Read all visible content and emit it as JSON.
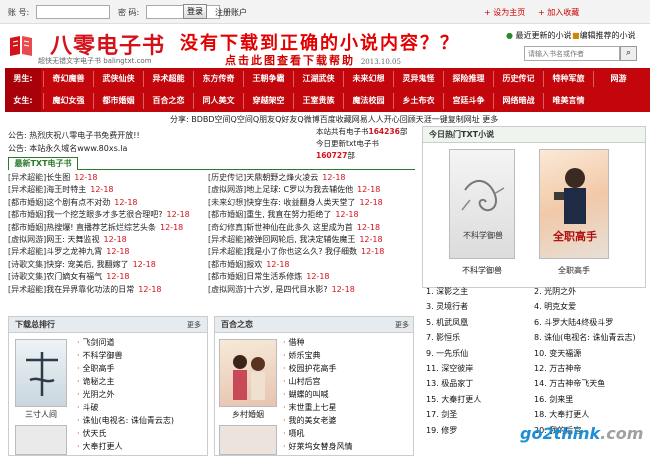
{
  "topbar": {
    "account_label": "账 号:",
    "password_label": "密 码:",
    "login_label": "登录",
    "register_label": "注册账户",
    "set_home": "+ 设为主页",
    "add_favorite": "+ 加入收藏"
  },
  "header": {
    "logo_title": "八零电子书",
    "logo_sub": "超快无错文字电子书 balingtxt.com",
    "slogan_main": "没有下载到正确的小说内容？？",
    "slogan_sub": "点击此图查看下载帮助",
    "slogan_date": "2013.10.05",
    "latest_update_link": "最近更新的小说",
    "recommend_link": "编辑推荐的小说",
    "search_placeholder": "请输入书名或作者",
    "search_icon": "magnifier-icon"
  },
  "nav": {
    "row1_label": "男生:",
    "row1": [
      "奇幻魔兽",
      "武侠仙侠",
      "异术超能",
      "东方传奇",
      "王朝争霸",
      "江湖武侠",
      "未来幻想",
      "灵异鬼怪",
      "探险推理",
      "历史传记",
      "特种军旅",
      "网游"
    ],
    "row2_label": "女生:",
    "row2": [
      "魔幻女强",
      "都市婚姻",
      "百合之恋",
      "同人美文",
      "穿越架空",
      "王室贵族",
      "魔法校园",
      "乡土布衣",
      "宫廷斗争",
      "网络暗战",
      "唯美言情"
    ]
  },
  "share": "分享: BDBD空间Q空间Q朋友Q好友Q微博百度收藏网易人人开心回顾天涯一键复制网址 更多",
  "notices": [
    "公告: 热烈庆祝八零电子书免费开放!!",
    "公告: 本站永久域名www.80xs.la"
  ],
  "stats": {
    "line1_prefix": "本站共有电子书",
    "line1_num": "164236",
    "line1_suffix": "部",
    "line2": "今日更新txt电子书",
    "line3_num": "160727",
    "line3_suffix": "部"
  },
  "latest": {
    "tab_label": "最新TXT电子书",
    "left": [
      {
        "cat": "[异术超能]",
        "title": "长生图",
        "date": "12-18"
      },
      {
        "cat": "[异术超能]",
        "title": "海王时特主",
        "date": "12-18"
      },
      {
        "cat": "[都市婚姻]",
        "title": "这个剧有点不对劲",
        "date": "12-18"
      },
      {
        "cat": "[都市婚姻]",
        "title": "我一个挖芝眼多才多艺很合理吧?",
        "date": "12-18"
      },
      {
        "cat": "[都市婚姻]",
        "title": "热搜爆! 直播荐艺拆烂综艺头条",
        "date": "12-18"
      },
      {
        "cat": "[虚拟网游]",
        "title": "网王: 天舞监视",
        "date": "12-18"
      },
      {
        "cat": "[异术超能]",
        "title": "斗罗之龙神九霄",
        "date": "12-18"
      },
      {
        "cat": "[诗歌文集]",
        "title": "快穿: 宠美后, 我翻嫁了",
        "date": "12-18"
      },
      {
        "cat": "[诗歌文集]",
        "title": "农门嫡女有福气",
        "date": "12-18"
      },
      {
        "cat": "[异术超能]",
        "title": "我在异界靠化功法的日常",
        "date": "12-18"
      }
    ],
    "right": [
      {
        "cat": "[历史传记]",
        "title": "天鼎朝野之烽火凌云",
        "date": "12-18"
      },
      {
        "cat": "[虚拟网游]",
        "title": "地上足球: C罗以为我去辅佐他",
        "date": "12-18"
      },
      {
        "cat": "[未来幻想]",
        "title": "快穿生存: 收益翻身人类天堂了",
        "date": "12-18"
      },
      {
        "cat": "[都市婚姻]",
        "title": "重生, 我直在努力拒绝了",
        "date": "12-18"
      },
      {
        "cat": "[奇幻修真]",
        "title": "斩世神仙在此多久 这里成为首",
        "date": "12-18"
      },
      {
        "cat": "[异术超能]",
        "title": "被弹回网轮后, 我决定辅佐魔王",
        "date": "12-18"
      },
      {
        "cat": "[异术超能]",
        "title": "我是小了你也这么久? 我仔细数",
        "date": "12-18"
      },
      {
        "cat": "[都市婚姻]",
        "title": "报欢",
        "date": "12-18"
      },
      {
        "cat": "[都市婚姻]",
        "title": "日常生活系修炼",
        "date": "12-18"
      },
      {
        "cat": "[虚拟网游]",
        "title": "十六岁, 是四代目水影?",
        "date": "12-18"
      }
    ]
  },
  "hot": {
    "title": "今日热门TXT小说",
    "covers": [
      {
        "caption": "不科学御兽",
        "cover_title": "不科学御兽"
      },
      {
        "caption": "全职高手",
        "cover_title": "全职高手"
      }
    ],
    "list_left": [
      "1. 深影之主",
      "3. 灵境行者",
      "5. 机武凤凰",
      "7. 影恒乐",
      "9. 一先乐仙",
      "11. 深空彼岸",
      "13. 极品家丁",
      "15. 大秦打更人",
      "17. 剑圣",
      "19. 修罗"
    ],
    "list_right": [
      "2. 光阴之外",
      "4. 明克女爱",
      "6. 斗罗大陆4终极斗罗",
      "8. 诛仙(电视名: 诛仙青云志)",
      "10. 变天福源",
      "12. 万古神帝",
      "14. 万古神帝飞天鱼",
      "16. 剑来里",
      "18. 大奉打更人",
      "20. 我的后宫"
    ]
  },
  "download_rank": {
    "title": "下载总排行",
    "more": "更多",
    "cover_caption": "三寸人间",
    "items": [
      "飞剑问道",
      "不科学御兽",
      "全职高手",
      "诡秘之主",
      "光阴之外",
      "斗破",
      "诛仙(电视名: 诛仙青云志)",
      "伏天氏",
      "大奉打更人"
    ]
  },
  "yuri": {
    "title": "百合之恋",
    "more": "更多",
    "cover_caption": "乡村婚姻",
    "items": [
      "借种",
      "娇乐宝典",
      "校园护花高手",
      "山村后宫",
      "蝴蝶的叫喊",
      "末世重上七星",
      "我的美女老婆",
      "嗫吼",
      "好莱坞女替身风情"
    ]
  },
  "watermark": {
    "main": "go2think",
    "suffix": ".com"
  }
}
